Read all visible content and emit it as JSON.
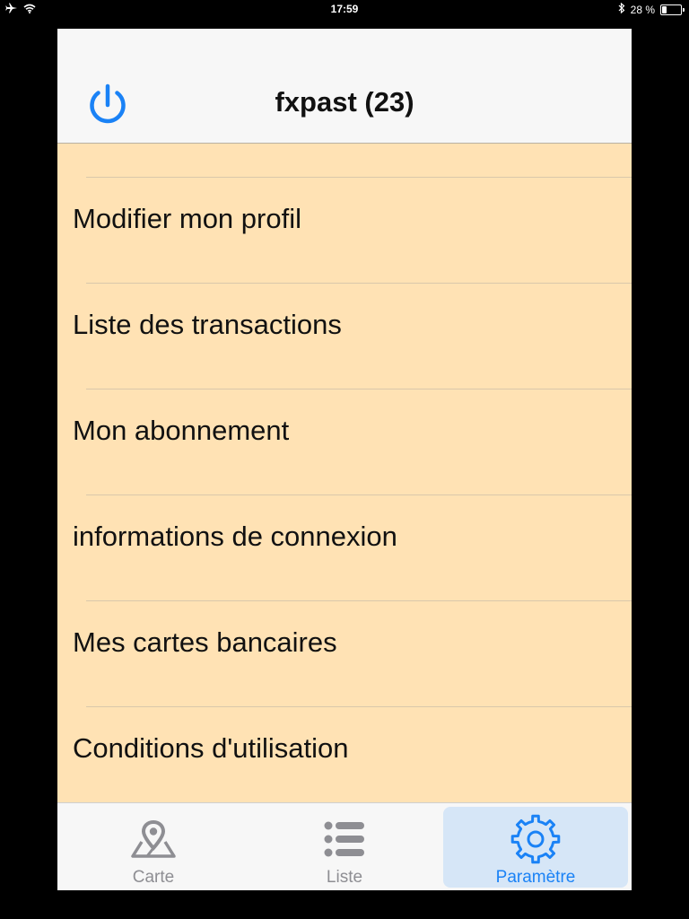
{
  "status_bar": {
    "time": "17:59",
    "battery_text": "28 %",
    "battery_level": 0.28,
    "airplane_icon": "airplane-icon",
    "wifi_icon": "wifi-icon",
    "bluetooth_icon": "bluetooth-icon"
  },
  "nav": {
    "title": "fxpast (23)",
    "power_icon": "power-icon",
    "accent_color": "#1a82f6"
  },
  "menu": {
    "background_color": "#ffe2b4",
    "items": [
      {
        "label": "Modifier mon profil"
      },
      {
        "label": "Liste des transactions"
      },
      {
        "label": "Mon abonnement"
      },
      {
        "label": "informations de connexion"
      },
      {
        "label": "Mes cartes bancaires"
      },
      {
        "label": "Conditions d'utilisation"
      }
    ]
  },
  "tabs": {
    "selected": "Paramètre",
    "items": [
      {
        "label": "Carte",
        "icon": "map-pin-icon"
      },
      {
        "label": "Liste",
        "icon": "list-icon"
      },
      {
        "label": "Paramètre",
        "icon": "gear-icon"
      }
    ]
  }
}
